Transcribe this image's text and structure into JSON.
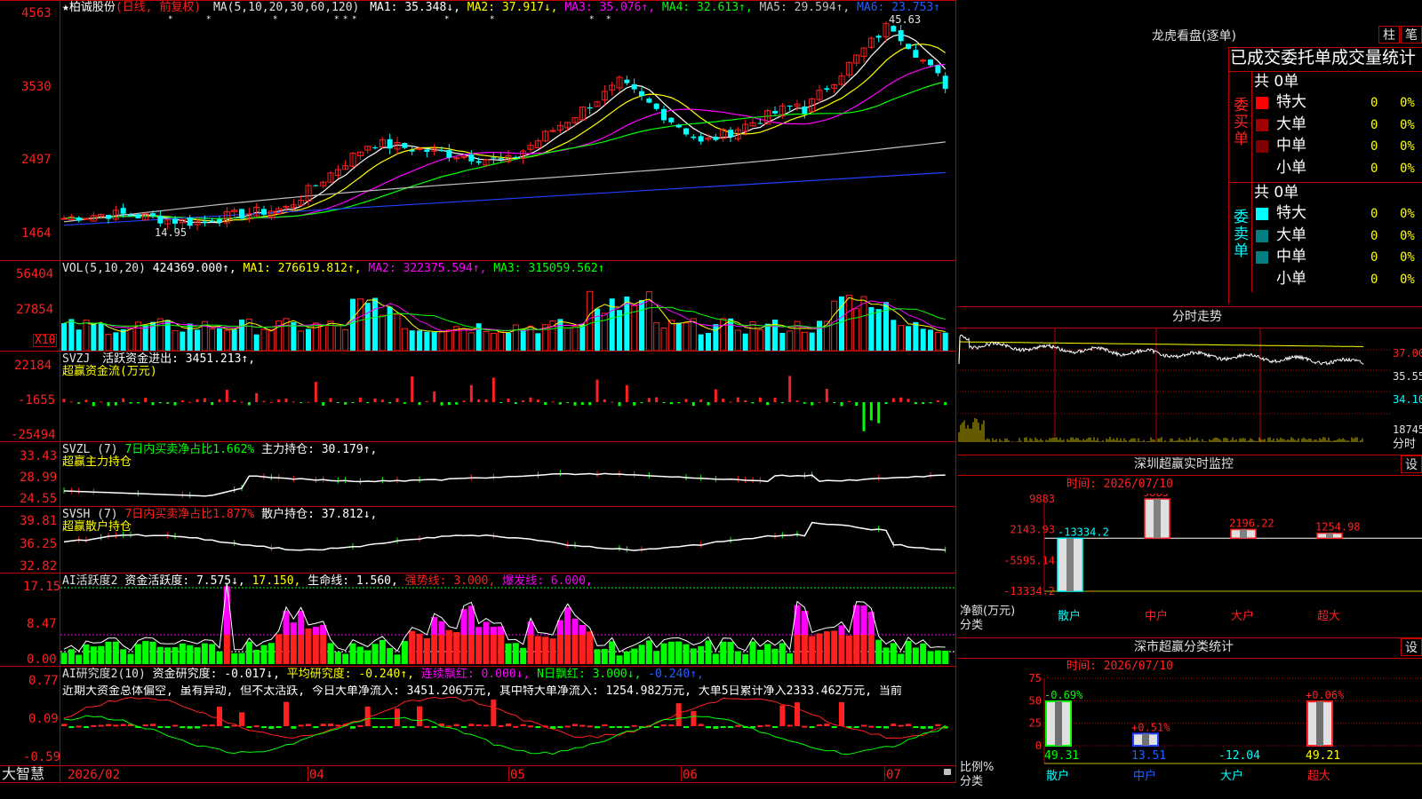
{
  "stock": {
    "star": "★",
    "name": "柏诚股份",
    "mode": "(日线, 前复权)"
  },
  "main_panel": {
    "ma_label": "MA(5,10,20,30,60,120)",
    "ma1": "MA1: 35.348↓,",
    "ma2": "MA2: 37.917↓,",
    "ma3": "MA3: 35.076↑,",
    "ma4": "MA4: 32.613↑,",
    "ma5": "MA5: 29.594↑,",
    "ma6": "MA6: 23.753↑",
    "y_ticks": [
      "4563",
      "3530",
      "2497",
      "1464"
    ],
    "high_label": "45.63",
    "low_label": "14.95"
  },
  "vol_panel": {
    "label": "VOL(5,10,20)",
    "value": "424369.000↑,",
    "ma1": "MA1: 276619.812↑,",
    "ma2": "MA2: 322375.594↑,",
    "ma3": "MA3: 315059.562↑",
    "y_ticks": [
      "56404",
      "27854"
    ],
    "unit": "X10"
  },
  "svzj_panel": {
    "label": "SVZJ",
    "value": "活跃资金进出: 3451.213↑,",
    "sub": "超赢资金流(万元)",
    "y_ticks": [
      "22184",
      "-1655",
      "-25494"
    ]
  },
  "svzl_panel": {
    "label": "SVZL (7)",
    "ratio": "7日内买卖净占比1.662%",
    "hold": "主力持仓: 30.179↑,",
    "sub": "超赢主力持仓",
    "y_ticks": [
      "33.43",
      "28.99",
      "24.55"
    ]
  },
  "svsh_panel": {
    "label": "SVSH (7)",
    "ratio": "7日内买卖净占比1.877%",
    "hold": "散户持仓: 37.812↓,",
    "sub": "超赢散户持仓",
    "y_ticks": [
      "39.81",
      "36.25",
      "32.82"
    ]
  },
  "ai1_panel": {
    "label": "AI活跃度2",
    "active": "资金活跃度: 7.575↓,",
    "v2": "17.150,",
    "life": "生命线: 1.560,",
    "strong": "强势线: 3.000,",
    "burst": "爆发线: 6.000,",
    "y_ticks": [
      "17.15",
      "8.47",
      "0.00"
    ]
  },
  "ai2_panel": {
    "label": "AI研究度2(10)",
    "research": "资金研究度: -0.017↓,",
    "avg": "平均研究度: -0.240↑,",
    "red": "连续飘红: 0.000↓,",
    "nred": "N日飘红: 3.000↓,",
    "last": "-0.240↑,",
    "comment": "近期大资金总体偏空, 虽有异动, 但不太活跃, 今日大单净流入: 3451.206万元, 其中特大单净流入: 1254.982万元, 大单5日累计净入2333.462万元, 当前",
    "y_ticks": [
      "0.77",
      "0.09",
      "-0.59"
    ]
  },
  "x_axis": {
    "labels": [
      "2026/02",
      "04",
      "05",
      "06",
      "07"
    ],
    "brand": "大智慧"
  },
  "right": {
    "lhkp_title": "龙虎看盘(逐单)",
    "btn_zhu": "柱",
    "btn_bi": "笔",
    "order_title": "已成交委托单成交量统计",
    "buy_label": "委买单",
    "sell_label": "委卖单",
    "buy_total": "共 0单",
    "sell_total": "共 0单",
    "buy_rows": [
      {
        "name": "特大",
        "n": "0",
        "p": "0%",
        "color": "#ff0000"
      },
      {
        "name": "大单",
        "n": "0",
        "p": "0%",
        "color": "#a00000"
      },
      {
        "name": "中单",
        "n": "0",
        "p": "0%",
        "color": "#800000"
      },
      {
        "name": "小单",
        "n": "0",
        "p": "0%",
        "color": "#000000"
      }
    ],
    "sell_rows": [
      {
        "name": "特大",
        "n": "0",
        "p": "0%",
        "color": "#00ffff"
      },
      {
        "name": "大单",
        "n": "0",
        "p": "0%",
        "color": "#008080"
      },
      {
        "name": "中单",
        "n": "0",
        "p": "0%",
        "color": "#008080"
      },
      {
        "name": "小单",
        "n": "0",
        "p": "0%",
        "color": "#000000"
      }
    ],
    "fs_title": "分时走势",
    "fs_ticks": [
      "37.00",
      "35.55",
      "34.10",
      "18745"
    ],
    "fs_unit": "分时",
    "mon_title": "深圳超赢实时监控",
    "mon_time": "时间: 2026/07/10",
    "mon_btn": "设",
    "mon_ticks": [
      "9883",
      "2143.93",
      "-5595.14",
      "-13334.2"
    ],
    "mon_axis_title": "净额(万元)",
    "mon_axis_cat": "分类",
    "cls_title": "深市超赢分类统计",
    "cls_time": "时间: 2026/07/10",
    "cls_btn": "设",
    "cls_ticks": [
      "75",
      "50",
      "25",
      "0"
    ],
    "cls_axis_title": "比例%",
    "cls_axis_cat": "分类"
  },
  "colors": {
    "up": "#ff2020",
    "down": "#00ffff",
    "frame": "#c00000",
    "ma1": "#ffffff",
    "ma2": "#ffff00",
    "ma3": "#ff00ff",
    "ma4": "#00ff00",
    "ma5": "#c0c0c0",
    "ma6": "#2040ff"
  },
  "chart_data": [
    {
      "type": "bar",
      "title": "深圳超赢实时监控",
      "ylabel": "净额(万元)",
      "xlabel": "分类",
      "categories": [
        "散户",
        "中户",
        "大户",
        "超大"
      ],
      "values": [
        -13334.2,
        9883,
        2196.22,
        1254.98
      ],
      "ylim": [
        -13334.2,
        9883
      ]
    },
    {
      "type": "bar",
      "title": "深市超赢分类统计",
      "ylabel": "比例%",
      "xlabel": "分类",
      "categories": [
        "散户",
        "中户",
        "大户",
        "超大"
      ],
      "values": [
        49.31,
        13.51,
        -12.04,
        49.21
      ],
      "top_labels": [
        "-0.69%",
        "+0.51%",
        "",
        "+0.06%"
      ],
      "bottom_labels": [
        "49.31",
        "13.51",
        "-12.04",
        "49.21"
      ],
      "ylim": [
        0,
        75
      ]
    }
  ]
}
